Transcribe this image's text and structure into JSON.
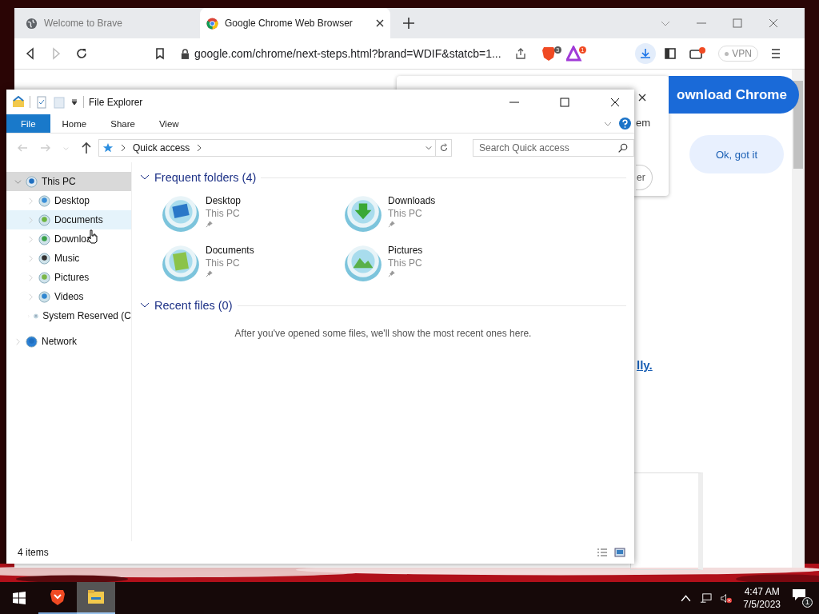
{
  "browser": {
    "tabs": [
      {
        "title": "Welcome to Brave",
        "selected": false
      },
      {
        "title": "Google Chrome Web Browser",
        "selected": true
      }
    ],
    "address": "google.com/chrome/next-steps.html?brand=WDIF&statcb=1...",
    "shields_count": "3",
    "rewards_count": "1",
    "vpn": "VPN",
    "page": {
      "popup_text": "em",
      "popup_button": "er",
      "download_button": "ownload Chrome",
      "ok_button": "Ok, got it",
      "link": "lly."
    }
  },
  "explorer": {
    "title": "File Explorer",
    "ribbon_tabs": [
      {
        "label": "File",
        "selected": true
      },
      {
        "label": "Home",
        "selected": false
      },
      {
        "label": "Share",
        "selected": false
      },
      {
        "label": "View",
        "selected": false
      }
    ],
    "address": "Quick access",
    "search": {
      "placeholder": "Search Quick access"
    },
    "nav": [
      {
        "label": "This PC",
        "selected": true,
        "hovered": false,
        "expanded": true,
        "children": [
          {
            "label": "Desktop",
            "selected": false,
            "hovered": false,
            "expanded": false
          },
          {
            "label": "Documents",
            "selected": false,
            "hovered": true,
            "expanded": false
          },
          {
            "label": "Downloa",
            "selected": false,
            "hovered": false,
            "expanded": false
          },
          {
            "label": "Music",
            "selected": false,
            "hovered": false,
            "expanded": false
          },
          {
            "label": "Pictures",
            "selected": false,
            "hovered": false,
            "expanded": false
          },
          {
            "label": "Videos",
            "selected": false,
            "hovered": false,
            "expanded": false
          },
          {
            "label": "System Reserved (C",
            "selected": false,
            "hovered": false,
            "expanded": false
          }
        ]
      },
      {
        "label": "Network",
        "selected": false,
        "hovered": false,
        "expanded": false
      }
    ],
    "frequent": {
      "heading": "Frequent folders (4)",
      "expanded": true,
      "items": [
        {
          "name": "Desktop",
          "location": "This PC",
          "pinned": true
        },
        {
          "name": "Downloads",
          "location": "This PC",
          "pinned": true
        },
        {
          "name": "Documents",
          "location": "This PC",
          "pinned": true
        },
        {
          "name": "Pictures",
          "location": "This PC",
          "pinned": true
        }
      ]
    },
    "recent": {
      "heading": "Recent files (0)",
      "expanded": true,
      "message": "After you've opened some files, we'll show the most recent ones here."
    },
    "status": "4 items"
  },
  "taskbar": {
    "apps": [
      {
        "kind": "brave",
        "active": false
      },
      {
        "kind": "explorer",
        "active": true
      }
    ],
    "time": "4:47 AM",
    "date": "7/5/2023",
    "notifications": "1"
  }
}
